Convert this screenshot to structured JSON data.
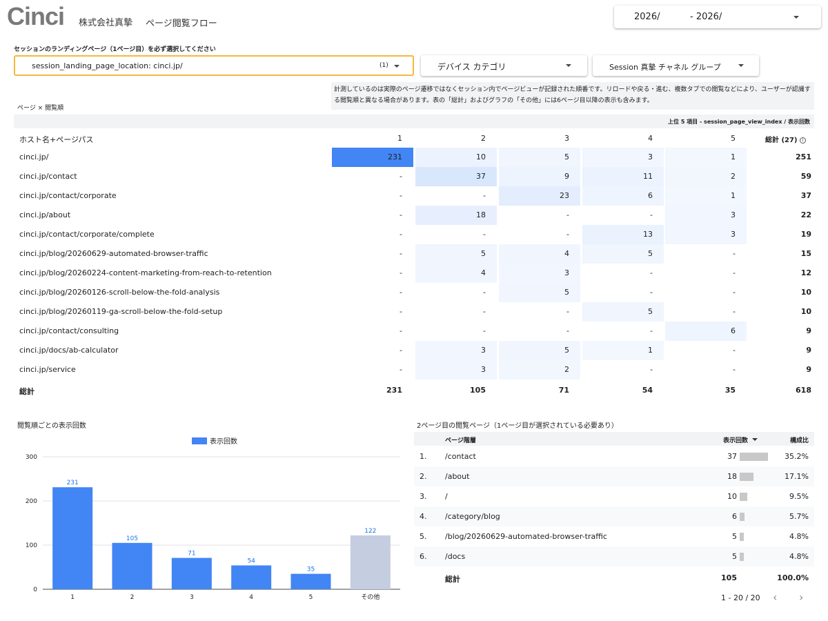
{
  "header": {
    "logo": "Cinci",
    "company": "株式会社真摯",
    "title": "ページ閲覧フロー",
    "date_from": "2026/",
    "date_to": "- 2026/"
  },
  "filters": {
    "note": "セッションのランディングページ（1ページ目）を必ず選択してください",
    "landing": "session_landing_page_location: cinci.jp/",
    "landing_count": "(1)",
    "device": "デバイス カテゴリ",
    "channel": "Session 真摯 チャネル グループ"
  },
  "pivot": {
    "title": "ページ × 閲覧順",
    "note": "計測しているのは実際のページ遷移ではなくセッション内でページビューが記録された順番です。リロードや戻る・進む、複数タブでの閲覧などにより、ユーザーが認識する閲覧順と異なる場合があります。表の「総計」およびグラフの「その他」には6ページ目以降の表示も含みます。",
    "top5_label": "上位 5 項目 - session_page_view_index / 表示回数",
    "row_header": "ホスト名+ページパス",
    "columns": [
      "1",
      "2",
      "3",
      "4",
      "5"
    ],
    "total_header": "総計 (27)",
    "info_icon": "i",
    "heat_color": "#4285f4",
    "rows": [
      {
        "label": "cinci.jp/",
        "values": [
          "231",
          "10",
          "5",
          "3",
          "1"
        ],
        "total": "251"
      },
      {
        "label": "cinci.jp/contact",
        "values": [
          "-",
          "37",
          "9",
          "11",
          "2"
        ],
        "total": "59"
      },
      {
        "label": "cinci.jp/contact/corporate",
        "values": [
          "-",
          "-",
          "23",
          "6",
          "1"
        ],
        "total": "37"
      },
      {
        "label": "cinci.jp/about",
        "values": [
          "-",
          "18",
          "-",
          "-",
          "3"
        ],
        "total": "22"
      },
      {
        "label": "cinci.jp/contact/corporate/complete",
        "values": [
          "-",
          "-",
          "-",
          "13",
          "3"
        ],
        "total": "19"
      },
      {
        "label": "cinci.jp/blog/20260629-automated-browser-traffic",
        "values": [
          "-",
          "5",
          "4",
          "5",
          "-"
        ],
        "total": "15"
      },
      {
        "label": "cinci.jp/blog/20260224-content-marketing-from-reach-to-retention",
        "values": [
          "-",
          "4",
          "3",
          "-",
          "-"
        ],
        "total": "12"
      },
      {
        "label": "cinci.jp/blog/20260126-scroll-below-the-fold-analysis",
        "values": [
          "-",
          "-",
          "5",
          "-",
          "-"
        ],
        "total": "10"
      },
      {
        "label": "cinci.jp/blog/20260119-ga-scroll-below-the-fold-setup",
        "values": [
          "-",
          "-",
          "-",
          "5",
          "-"
        ],
        "total": "10"
      },
      {
        "label": "cinci.jp/contact/consulting",
        "values": [
          "-",
          "-",
          "-",
          "-",
          "6"
        ],
        "total": "9"
      },
      {
        "label": "cinci.jp/docs/ab-calculator",
        "values": [
          "-",
          "3",
          "5",
          "1",
          "-"
        ],
        "total": "9"
      },
      {
        "label": "cinci.jp/service",
        "values": [
          "-",
          "3",
          "2",
          "-",
          "-"
        ],
        "total": "9"
      }
    ],
    "totals": {
      "label": "総計",
      "values": [
        "231",
        "105",
        "71",
        "54",
        "35"
      ],
      "total": "618"
    }
  },
  "chart_data": {
    "type": "bar",
    "title": "閲覧順ごとの表示回数",
    "categories": [
      "1",
      "2",
      "3",
      "4",
      "5",
      "その他"
    ],
    "series": [
      {
        "name": "表示回数",
        "values": [
          231,
          105,
          71,
          54,
          35,
          122
        ],
        "color": "#4285f4"
      }
    ],
    "other_color": "#c5cde0",
    "yticks": [
      "0",
      "100",
      "200",
      "300"
    ],
    "ylim": [
      0,
      300
    ],
    "legend": "top-center",
    "grid": true
  },
  "page2": {
    "title": "2ページ目の閲覧ページ（1ページ目が選択されている必要あり）",
    "headers": {
      "page": "ページ階層",
      "count": "表示回数",
      "ratio": "構成比"
    },
    "sort_icon": "sort-desc-icon",
    "rows": [
      {
        "idx": "1.",
        "page": "/contact",
        "count": "37",
        "ratio": "35.2%",
        "share": 0.352
      },
      {
        "idx": "2.",
        "page": "/about",
        "count": "18",
        "ratio": "17.1%",
        "share": 0.171
      },
      {
        "idx": "3.",
        "page": "/",
        "count": "10",
        "ratio": "9.5%",
        "share": 0.095
      },
      {
        "idx": "4.",
        "page": "/category/blog",
        "count": "6",
        "ratio": "5.7%",
        "share": 0.057
      },
      {
        "idx": "5.",
        "page": "/blog/20260629-automated-browser-traffic",
        "count": "5",
        "ratio": "4.8%",
        "share": 0.048
      },
      {
        "idx": "6.",
        "page": "/docs",
        "count": "5",
        "ratio": "4.8%",
        "share": 0.048
      }
    ],
    "total": {
      "label": "総計",
      "count": "105",
      "ratio": "100.0%"
    },
    "pager": "1 - 20 / 20",
    "prev": "‹",
    "next": "›"
  }
}
